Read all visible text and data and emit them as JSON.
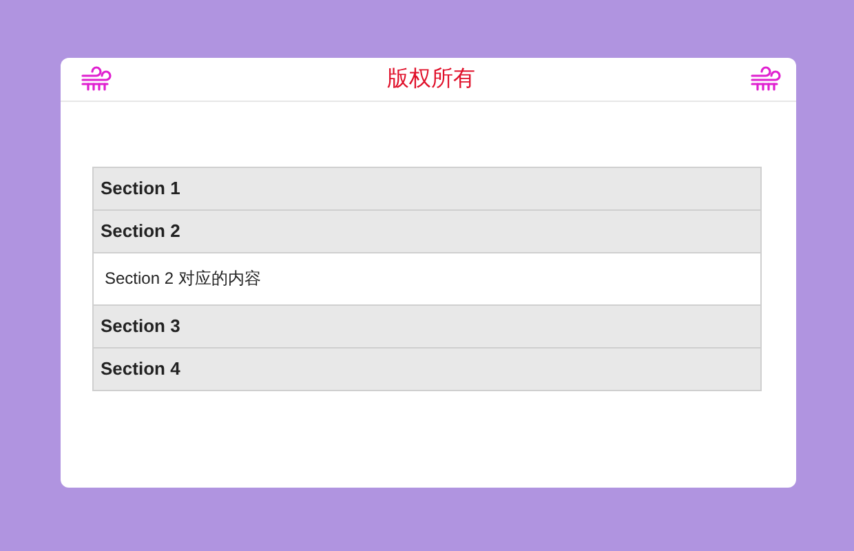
{
  "header": {
    "title": "版权所有"
  },
  "accordion": [
    {
      "title": "Section 1"
    },
    {
      "title": "Section 2",
      "content": "Section 2 对应的内容"
    },
    {
      "title": "Section 3"
    },
    {
      "title": "Section 4"
    }
  ]
}
